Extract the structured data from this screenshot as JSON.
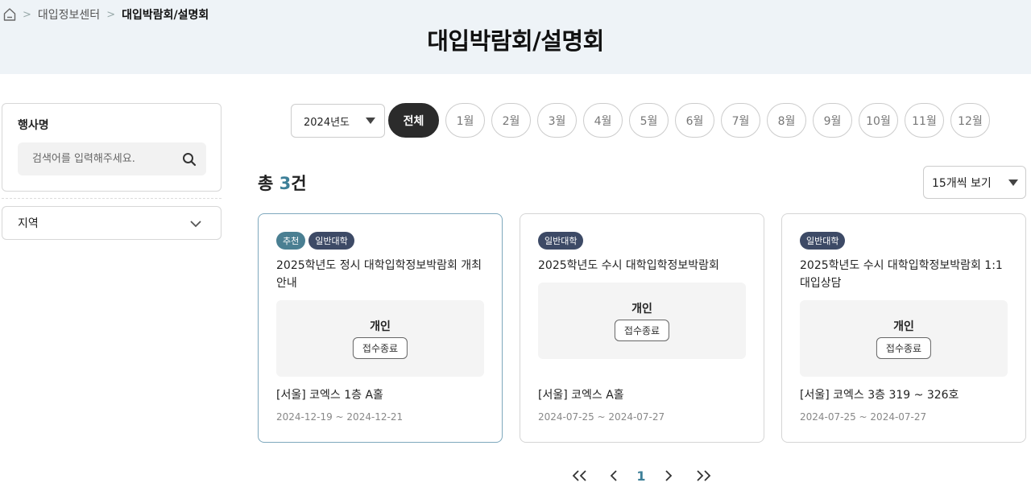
{
  "breadcrumb": {
    "home_icon": "home-icon",
    "items": [
      "대입정보센터",
      "대입박람회/설명회"
    ]
  },
  "page": {
    "title": "대입박람회/설명회"
  },
  "filters": {
    "event_name_label": "행사명",
    "search_placeholder": "검색어를 입력해주세요.",
    "search_value": "",
    "search_icon": "search-icon",
    "region_label": "지역",
    "region_icon": "chevron-down-icon"
  },
  "toolbar": {
    "year_selected": "2024년도",
    "months": [
      "전체",
      "1월",
      "2월",
      "3월",
      "4월",
      "5월",
      "6월",
      "7월",
      "8월",
      "9월",
      "10월",
      "11월",
      "12월"
    ],
    "active_month": "전체"
  },
  "results": {
    "total_prefix": "총 ",
    "count": "3",
    "total_suffix": "건",
    "per_page": "15개씩 보기"
  },
  "cards": [
    {
      "badges": [
        "추천",
        "일반대학"
      ],
      "title": "2025학년도 정시 대학입학정보박람회 개최 안내",
      "type": "개인",
      "status": "접수종료",
      "location": "[서울] 코엑스 1층 A홀",
      "dates": "2024-12-19 ~ 2024-12-21"
    },
    {
      "badges": [
        "일반대학"
      ],
      "title": "2025학년도 수시 대학입학정보박람회",
      "type": "개인",
      "status": "접수종료",
      "location": "[서울] 코엑스 A홀",
      "dates": "2024-07-25 ~ 2024-07-27"
    },
    {
      "badges": [
        "일반대학"
      ],
      "title": "2025학년도 수시 대학입학정보박람회 1:1 대입상담",
      "type": "개인",
      "status": "접수종료",
      "location": "[서울] 코엑스 3층 319 ~ 326호",
      "dates": "2024-07-25 ~ 2024-07-27"
    }
  ],
  "pagination": {
    "current_page": "1"
  },
  "colors": {
    "accent": "#3d7f98",
    "header_bg": "#eef3f7",
    "badge_recommend": "#4a7f92",
    "badge_general": "#3d4a66"
  }
}
